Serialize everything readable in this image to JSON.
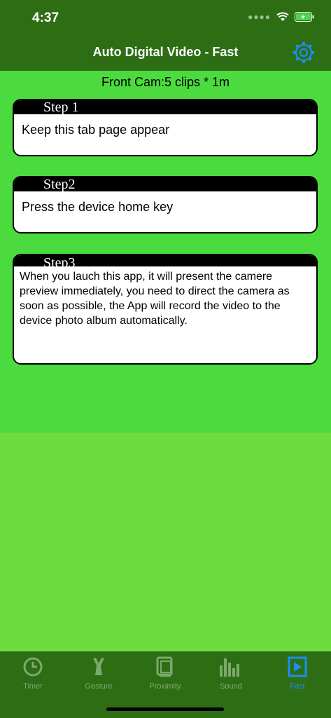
{
  "status_bar": {
    "time": "4:37"
  },
  "nav": {
    "title": "Auto Digital Video - Fast"
  },
  "main": {
    "subtitle": "Front Cam:5 clips * 1m",
    "steps": [
      {
        "header": "Step 1",
        "text": "Keep this tab page appear"
      },
      {
        "header": "Step2",
        "text": "Press the device home key"
      },
      {
        "header": "Step3",
        "text": "When you lauch this app, it will present the camere preview immediately, you need to direct the camera as soon as possible, the App will record the video to the device photo album automatically."
      }
    ]
  },
  "tabs": [
    {
      "label": "Timer",
      "icon": "clock-icon"
    },
    {
      "label": "Gesture",
      "icon": "hand-icon"
    },
    {
      "label": "Proximity",
      "icon": "proximity-icon"
    },
    {
      "label": "Sound",
      "icon": "sound-bars-icon"
    },
    {
      "label": "Fast",
      "icon": "play-icon",
      "active": true
    }
  ],
  "colors": {
    "topbar": "#2d6e15",
    "main_bg": "#4cdb3e",
    "page_bg": "#6cdc3e",
    "accent": "#1c8ff0"
  }
}
